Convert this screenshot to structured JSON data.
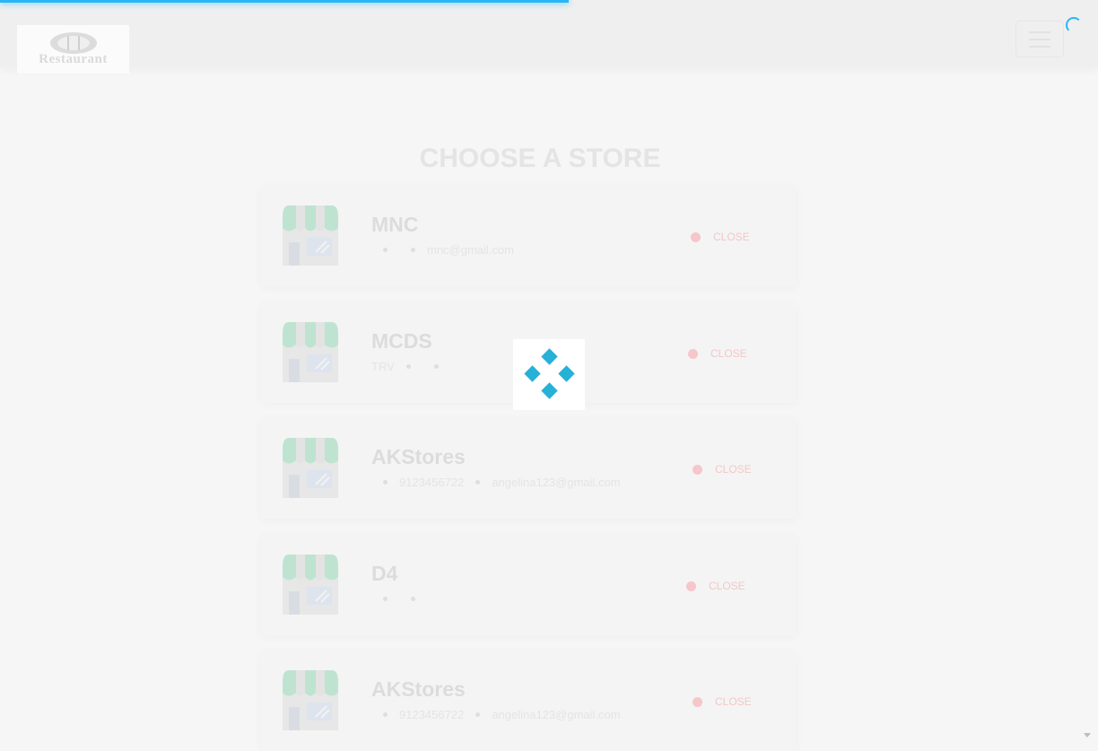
{
  "header": {
    "logo_text": "Restaurant",
    "logo_icon": "fork-plate-icon",
    "menu_icon": "hamburger-icon",
    "loading_icon": "spinner-icon",
    "progress_color": "#29b6f6"
  },
  "page": {
    "title": "CHOOSE A STORE"
  },
  "stores": [
    {
      "name": "MNC",
      "location": "",
      "phone": "",
      "email": "mnc@gmail.com",
      "status": "CLOSE"
    },
    {
      "name": "MCDS",
      "location": "TRV",
      "phone": "",
      "email": "",
      "status": "CLOSE"
    },
    {
      "name": "AKStores",
      "location": "",
      "phone": "9123456722",
      "email": "angelina123@gmail.com",
      "status": "CLOSE"
    },
    {
      "name": "D4",
      "location": "",
      "phone": "",
      "email": "",
      "status": "CLOSE"
    },
    {
      "name": "AKStores",
      "location": "",
      "phone": "9123456722",
      "email": "angelina123@gmail.com",
      "status": "CLOSE"
    }
  ],
  "overlay": {
    "loader_icon": "diamond-loader-icon",
    "loader_color": "#26b1d6"
  },
  "colors": {
    "status_closed": "#f6c6ca",
    "page_background": "#f6f6f6"
  }
}
